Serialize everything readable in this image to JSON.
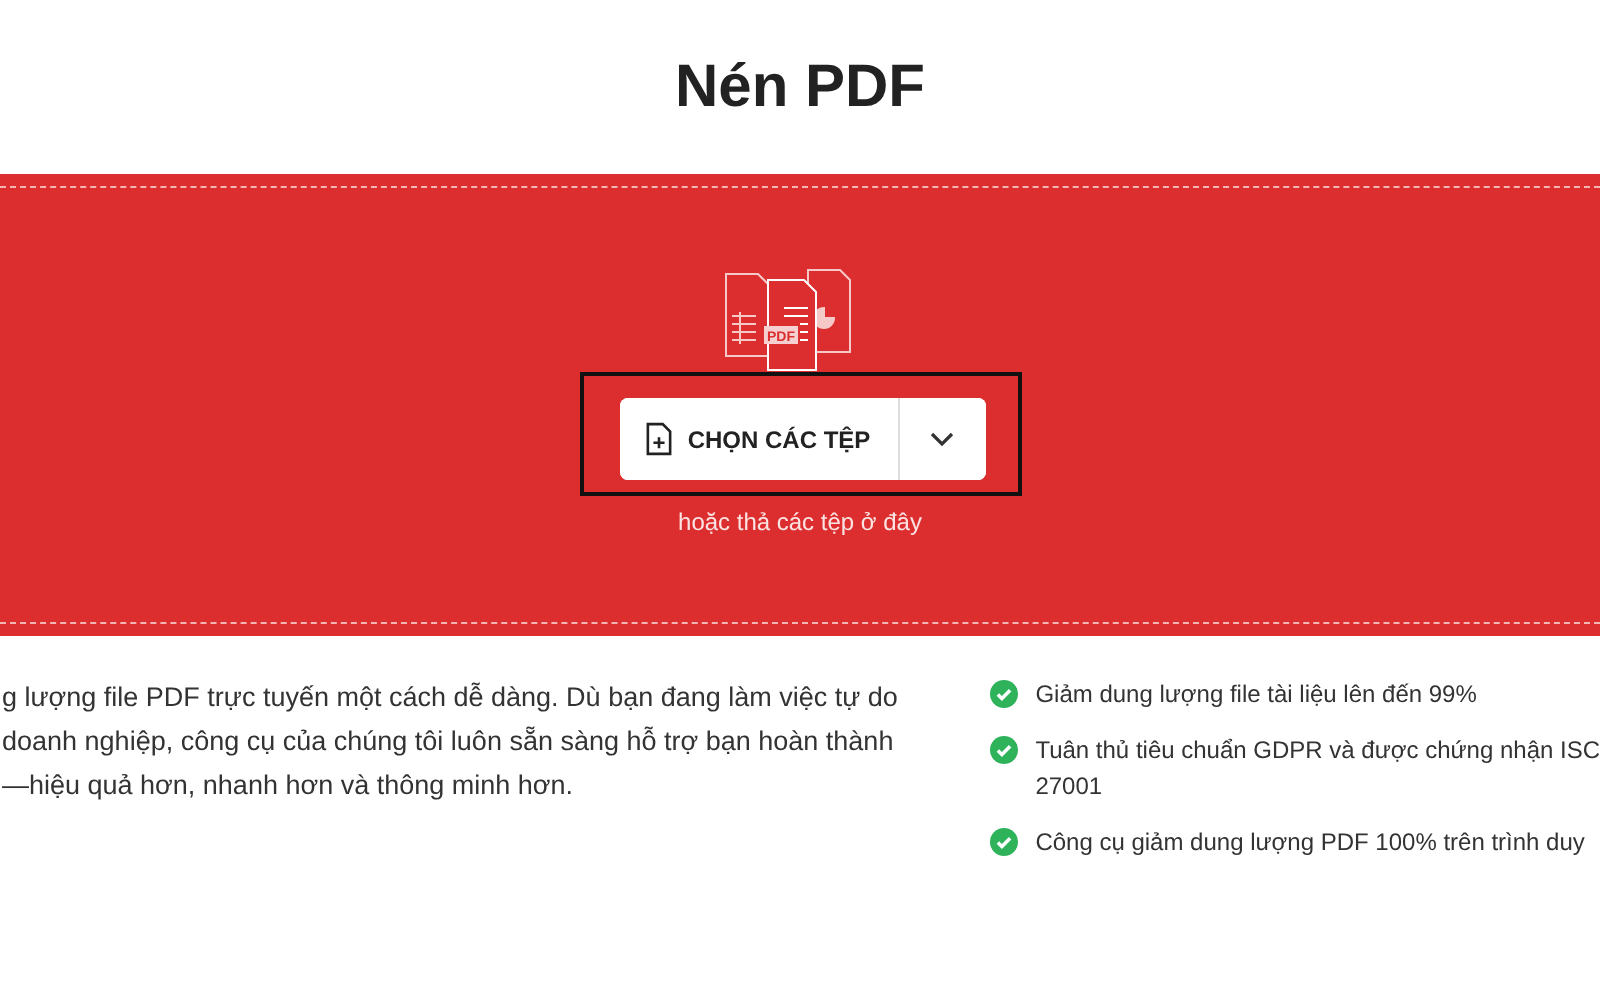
{
  "title": "Nén PDF",
  "upload": {
    "icon_label": "PDF",
    "button": "CHỌN CÁC TỆP",
    "hint": "hoặc thả các tệp ở đây",
    "focused": true
  },
  "description": [
    "g lượng file PDF trực tuyến một cách dễ dàng. Dù bạn đang làm việc tự do",
    "doanh nghiệp, công cụ của chúng tôi luôn sẵn sàng hỗ trợ bạn hoàn thành",
    "—hiệu quả hơn, nhanh hơn và thông minh hơn."
  ],
  "features": [
    {
      "text": "Giảm dung lượng file tài liệu lên đến 99%"
    },
    {
      "text": "Tuân thủ tiêu chuẩn GDPR và được chứng nhận ISC",
      "continuation": "27001"
    },
    {
      "text": "Công cụ giảm dung lượng PDF 100% trên trình duy"
    }
  ]
}
